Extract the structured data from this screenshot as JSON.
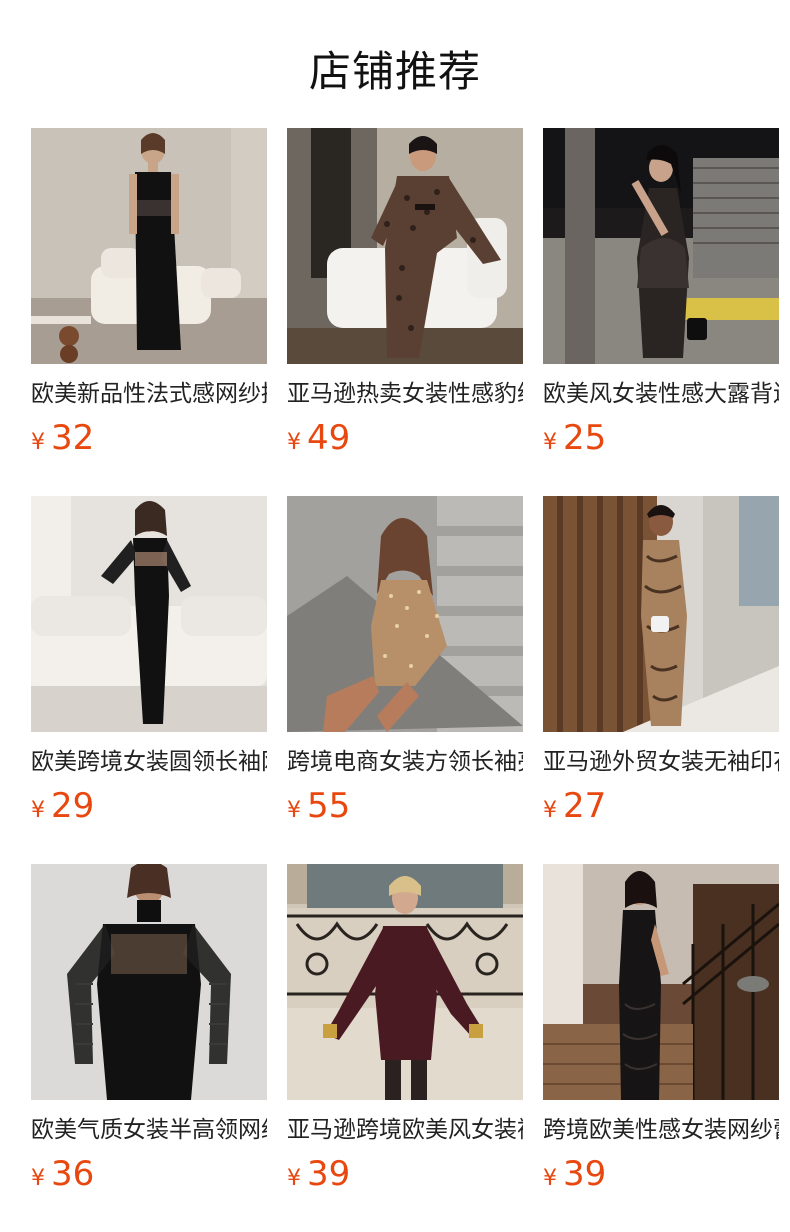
{
  "page": {
    "title": "店铺推荐"
  },
  "colors": {
    "price": "#e8480f",
    "title": "#111111",
    "name": "#222222"
  },
  "products": [
    {
      "name": "欧美新品性法式感网纱拼接吊带连衣裙",
      "currency": "¥",
      "price": "32",
      "image": "woman-black-slip-dress-photo"
    },
    {
      "name": "亚马逊热卖女装性感豹纹网纱长裙",
      "currency": "¥",
      "price": "49",
      "image": "woman-leopard-mesh-dress-photo"
    },
    {
      "name": "欧美风女装性感大露背连衣裙",
      "currency": "¥",
      "price": "25",
      "image": "woman-backless-black-dress-photo"
    },
    {
      "name": "欧美跨境女装圆领长袖网纱连衣裙",
      "currency": "¥",
      "price": "29",
      "image": "woman-black-mesh-sleeve-dress-photo"
    },
    {
      "name": "跨境电商女装方领长袖亮片短裙",
      "currency": "¥",
      "price": "55",
      "image": "woman-sequin-mini-dress-photo"
    },
    {
      "name": "亚马逊外贸女装无袖印花长裙",
      "currency": "¥",
      "price": "27",
      "image": "woman-printed-sleeveless-dress-photo"
    },
    {
      "name": "欧美气质女装半高领网纱长袖连衣裙",
      "currency": "¥",
      "price": "36",
      "image": "woman-turtleneck-mesh-dress-photo"
    },
    {
      "name": "亚马逊跨境欧美风女装褶皱短裙",
      "currency": "¥",
      "price": "39",
      "image": "woman-burgundy-ruched-dress-photo"
    },
    {
      "name": "跨境欧美性感女装网纱蕾丝长裙",
      "currency": "¥",
      "price": "39",
      "image": "woman-black-lace-maxi-dress-photo"
    }
  ]
}
